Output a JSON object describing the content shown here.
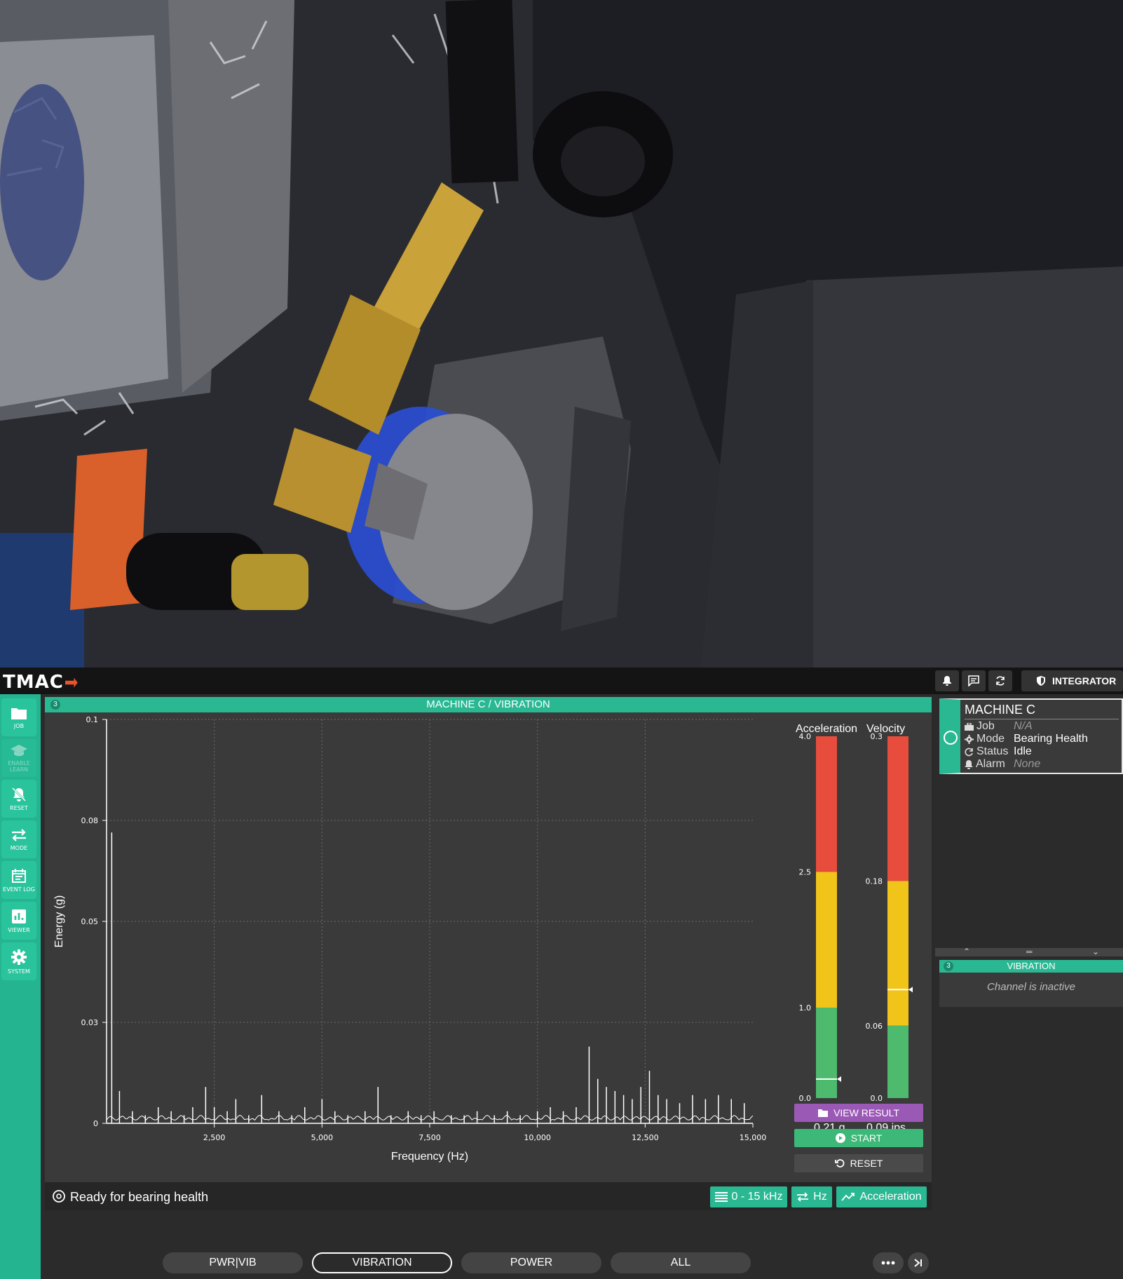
{
  "app": {
    "logo": "TMAC",
    "integrator_label": "INTEGRATOR"
  },
  "sidenav": [
    {
      "label": "JOB",
      "icon": "folder-icon"
    },
    {
      "label": "ENABLE LEARN",
      "icon": "learn-icon",
      "disabled": true
    },
    {
      "label": "RESET",
      "icon": "bell-off-icon"
    },
    {
      "label": "MODE",
      "icon": "swap-icon"
    },
    {
      "label": "EVENT LOG",
      "icon": "calendar-icon"
    },
    {
      "label": "VIEWER",
      "icon": "bar-chart-icon"
    },
    {
      "label": "SYSTEM",
      "icon": "gear-icon"
    }
  ],
  "main": {
    "badge": "3",
    "title": "MACHINE C / VIBRATION",
    "status_text": "Ready for bearing health",
    "range_label": "0 - 15 kHz",
    "unit_label": "Hz",
    "measure_label": "Acceleration"
  },
  "gauges": {
    "acceleration": {
      "title": "Acceleration",
      "ticks": [
        "4.0",
        "2.5",
        "1.0",
        "0.0"
      ],
      "value_text": "0.21 g",
      "value": 0.21,
      "max": 4.0,
      "red_from": 2.5,
      "yellow_from": 1.0
    },
    "velocity": {
      "title": "Velocity",
      "ticks": [
        "0.3",
        "0.18",
        "0.06",
        "0.0"
      ],
      "value_text": "0.09 ips",
      "value": 0.09,
      "max": 0.3,
      "red_from": 0.18,
      "yellow_from": 0.06
    }
  },
  "buttons": {
    "view_result": "VIEW RESULT",
    "start": "START",
    "reset": "RESET"
  },
  "tabs": [
    "PWR|VIB",
    "VIBRATION",
    "POWER",
    "ALL"
  ],
  "active_tab": "VIBRATION",
  "machine": {
    "name": "MACHINE C",
    "job_label": "Job",
    "job_value": "N/A",
    "mode_label": "Mode",
    "mode_value": "Bearing Health",
    "status_label": "Status",
    "status_value": "Idle",
    "alarm_label": "Alarm",
    "alarm_value": "None"
  },
  "vibration_channel": {
    "badge": "3",
    "title": "VIBRATION",
    "message": "Channel is inactive"
  },
  "colors": {
    "accent": "#2ab893",
    "purple": "#9b59b6",
    "green": "#3cb878",
    "red": "#e74c3c",
    "yellow": "#f0c419",
    "gauge_green": "#4dba6e"
  },
  "chart_data": {
    "type": "line",
    "xlabel": "Frequency (Hz)",
    "ylabel": "Energy (g)",
    "xlim": [
      0,
      15000
    ],
    "ylim": [
      0,
      0.1
    ],
    "x_ticks": [
      "2,500",
      "5,000",
      "7,500",
      "10,000",
      "12,500",
      "15,000"
    ],
    "y_ticks": [
      "0.1",
      "0.08",
      "0.05",
      "0.03",
      "0"
    ],
    "grid": true,
    "series": [
      {
        "x": [
          120,
          300,
          600,
          900,
          1200,
          1500,
          1800,
          2000,
          2300,
          2500,
          2800,
          3000,
          3300,
          3600,
          4000,
          4300,
          4600,
          5000,
          5300,
          5600,
          6000,
          6300,
          6600,
          7000,
          7300,
          7600,
          8000,
          8300,
          8600,
          9000,
          9300,
          9600,
          10000,
          10300,
          10600,
          10900,
          11200,
          11400,
          11600,
          11800,
          12000,
          12200,
          12400,
          12600,
          12800,
          13000,
          13300,
          13600,
          13900,
          14200,
          14500,
          14800
        ],
        "y": [
          0.072,
          0.008,
          0.003,
          0.002,
          0.004,
          0.003,
          0.002,
          0.004,
          0.009,
          0.004,
          0.003,
          0.006,
          0.002,
          0.007,
          0.003,
          0.002,
          0.004,
          0.006,
          0.003,
          0.002,
          0.003,
          0.009,
          0.002,
          0.003,
          0.002,
          0.003,
          0.002,
          0.002,
          0.003,
          0.002,
          0.003,
          0.002,
          0.003,
          0.004,
          0.003,
          0.004,
          0.019,
          0.011,
          0.009,
          0.008,
          0.007,
          0.006,
          0.009,
          0.013,
          0.007,
          0.006,
          0.005,
          0.007,
          0.006,
          0.007,
          0.006,
          0.005
        ]
      }
    ]
  }
}
